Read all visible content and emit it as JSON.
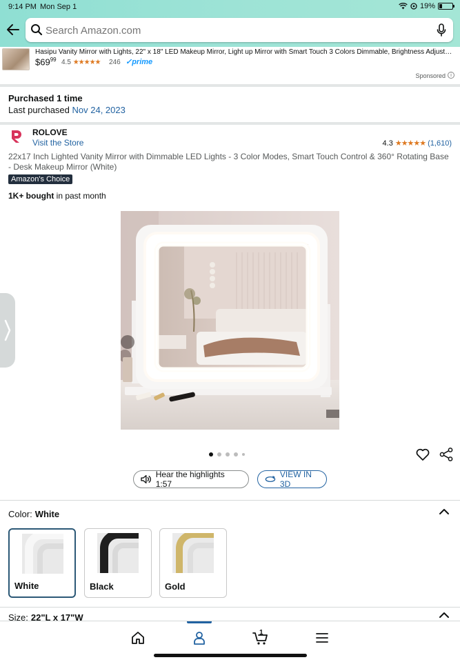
{
  "status": {
    "time": "9:14 PM",
    "date": "Mon Sep 1",
    "battery": "19%"
  },
  "search": {
    "placeholder": "Search Amazon.com"
  },
  "ad": {
    "title": "Hasipu Vanity Mirror with Lights, 22\" x 18\" LED Makeup Mirror, Light up Mirror with Smart Touch 3 Colors Dimmable, Brightness Adjustme...",
    "price_whole": "$69",
    "price_fraction": "99",
    "rating": "4.5",
    "stars": "★★★★★",
    "review_count": "246",
    "prime": "✓prime",
    "sponsored": "Sponsored",
    "info": "i"
  },
  "purchase": {
    "line1": "Purchased 1 time",
    "line2_prefix": "Last purchased ",
    "line2_date": "Nov 24, 2023"
  },
  "product": {
    "brand": "ROLOVE",
    "store_link": "Visit the Store",
    "rating": "4.3",
    "stars": "★★★★★",
    "rating_count": "(1,610)",
    "title": "22x17 Inch Lighted Vanity Mirror with Dimmable LED Lights - 3 Color Modes, Smart Touch Control & 360° Rotating Base - Desk Makeup Mirror (White)",
    "badge": "Amazon's Choice",
    "bought_bold": "1K+ bought",
    "bought_rest": " in past month"
  },
  "carousel": {
    "total": 5,
    "active": 0
  },
  "actions": {
    "highlights": "Hear the highlights 1:57",
    "view3d": "VIEW IN 3D"
  },
  "color": {
    "label": "Color:",
    "selected": "White",
    "options": [
      {
        "name": "White",
        "frame": "#e6e6e6"
      },
      {
        "name": "Black",
        "frame": "#1f1f1f"
      },
      {
        "name": "Gold",
        "frame": "#cfb66a"
      }
    ]
  },
  "size": {
    "label": "Size:",
    "selected": "22\"L x 17\"W"
  },
  "tabbar": {
    "cart_count": "1",
    "active_tab": "profile"
  },
  "colors": {
    "header_teal": "#9de3d6",
    "link_blue": "#2162a1",
    "star_orange": "#de7921",
    "prime_blue": "#1399ff",
    "badge_navy": "#232f3e"
  }
}
